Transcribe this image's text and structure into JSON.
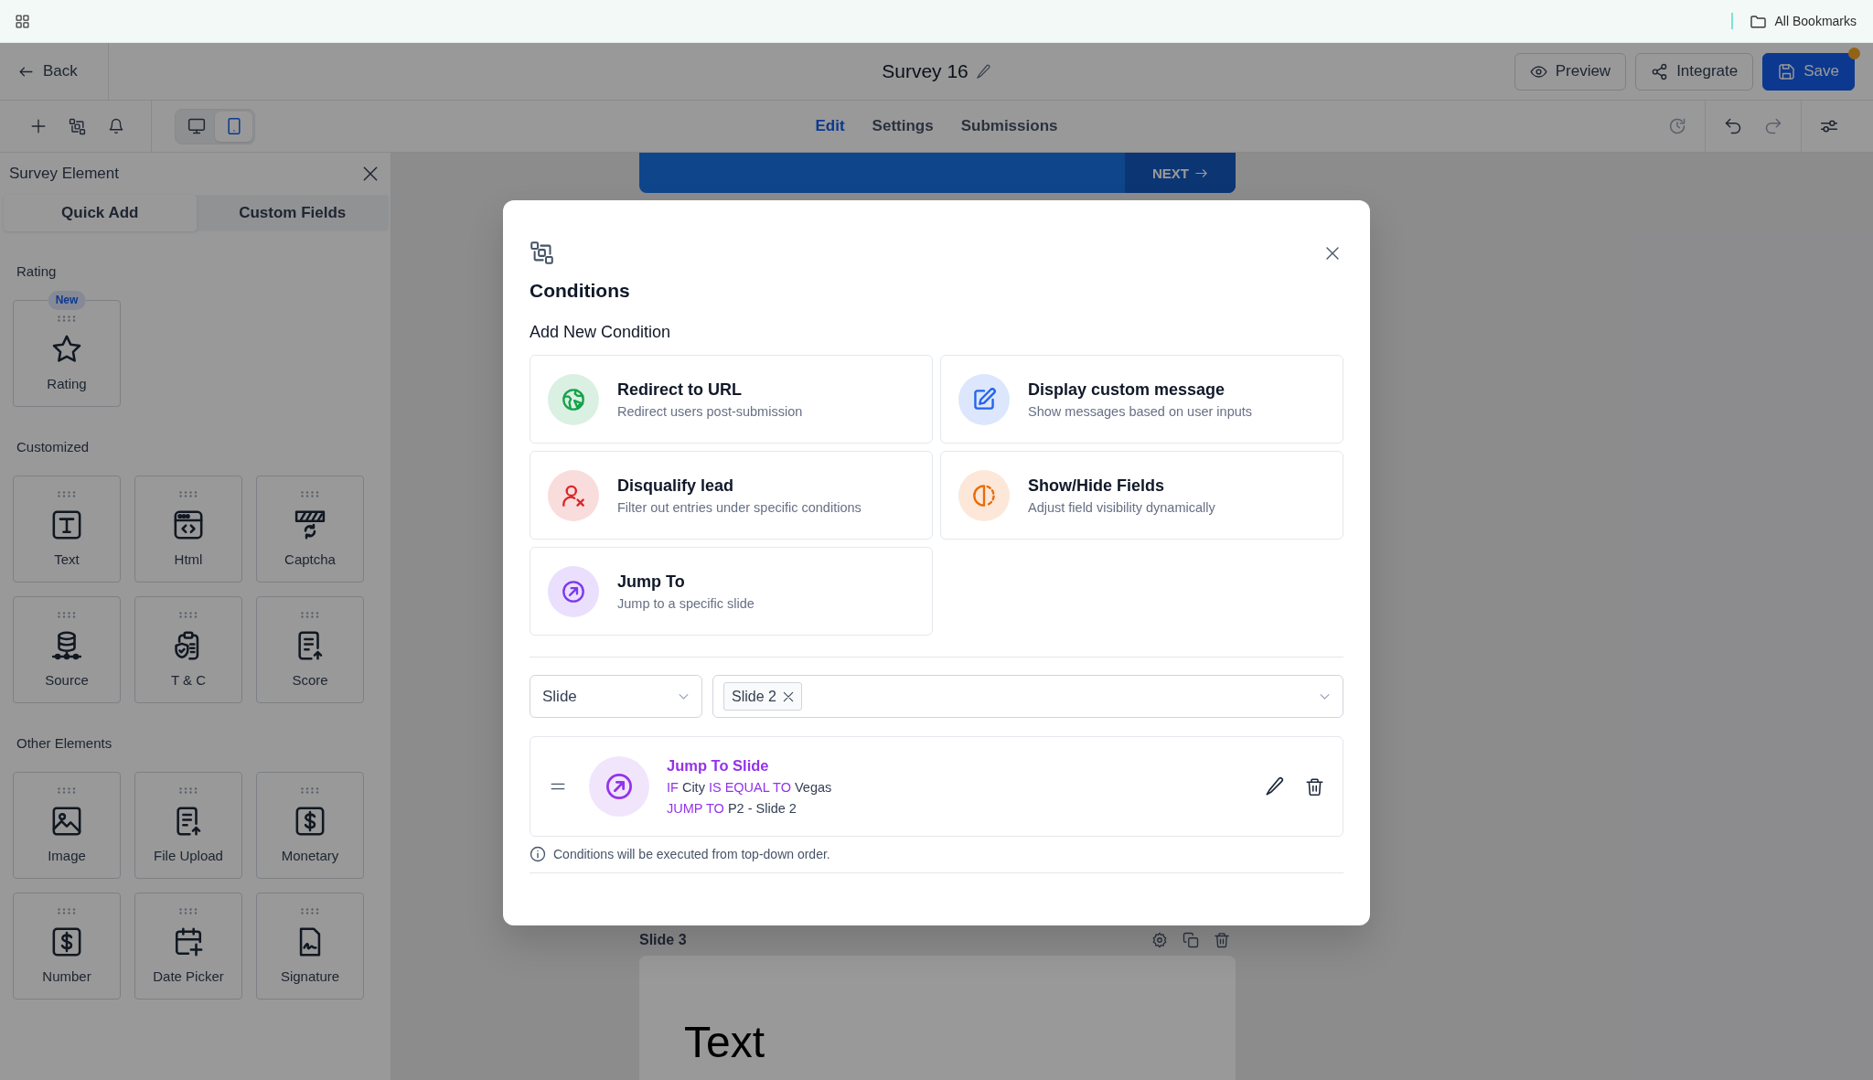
{
  "bookmarks_bar": {
    "label": "All Bookmarks"
  },
  "header": {
    "back": "Back",
    "title": "Survey 16",
    "buttons": [
      {
        "label": "Preview",
        "kind": "outline",
        "indicator": false
      },
      {
        "label": "Integrate",
        "kind": "outline",
        "indicator": false
      },
      {
        "label": "Save",
        "kind": "primary",
        "indicator": true
      }
    ]
  },
  "toolbar": {
    "devices": [
      {
        "selected": false
      },
      {
        "selected": true
      }
    ],
    "tabs": [
      {
        "label": "Edit",
        "selected": true
      },
      {
        "label": "Settings",
        "selected": false
      },
      {
        "label": "Submissions",
        "selected": false
      }
    ],
    "undo_redo": [
      {
        "disabled": false
      },
      {
        "disabled": true
      }
    ]
  },
  "sidebar": {
    "title": "Survey Element",
    "tabs": [
      {
        "label": "Quick Add",
        "selected": true
      },
      {
        "label": "Custom Fields",
        "selected": false
      }
    ],
    "sections": [
      {
        "title": "Rating",
        "items": [
          {
            "label": "Rating",
            "badge": "New"
          }
        ]
      },
      {
        "title": "Customized",
        "items": [
          {
            "label": "Text"
          },
          {
            "label": "Html"
          },
          {
            "label": "Captcha"
          },
          {
            "label": "Source"
          },
          {
            "label": "T & C"
          },
          {
            "label": "Score"
          }
        ]
      },
      {
        "title": "Other Elements",
        "items": [
          {
            "label": "Image"
          },
          {
            "label": "File Upload"
          },
          {
            "label": "Monetary"
          },
          {
            "label": "Number"
          },
          {
            "label": "Date Picker"
          },
          {
            "label": "Signature"
          }
        ]
      }
    ]
  },
  "canvas": {
    "next_button": "NEXT",
    "slide_label": "Slide 3",
    "slide_heading": "Text"
  },
  "modal": {
    "title": "Conditions",
    "subtitle": "Add New Condition",
    "options": [
      {
        "title": "Redirect to URL",
        "description": "Redirect users post-submission",
        "color": "#16a34a"
      },
      {
        "title": "Display custom message",
        "description": "Show messages based on user inputs",
        "color": "#2563eb"
      },
      {
        "title": "Disqualify lead",
        "description": "Filter out entries under specific conditions",
        "color": "#dc2626"
      },
      {
        "title": "Show/Hide Fields",
        "description": "Adjust field visibility dynamically",
        "color": "#ea6c0a"
      },
      {
        "title": "Jump To",
        "description": "Jump to a specific slide",
        "color": "#7c3aed"
      }
    ],
    "type_select": {
      "value": "Slide"
    },
    "target_select": {
      "tags": [
        "Slide 2"
      ]
    },
    "conditions": [
      {
        "title": "Jump To Slide",
        "lines": [
          [
            {
              "kind": "keyword",
              "text": "IF"
            },
            {
              "kind": "value",
              "text": "City"
            },
            {
              "kind": "keyword",
              "text": "IS EQUAL TO"
            },
            {
              "kind": "value",
              "text": "Vegas"
            }
          ],
          [
            {
              "kind": "keyword",
              "text": "JUMP TO"
            },
            {
              "kind": "value",
              "text": "P2 - Slide 2"
            }
          ]
        ]
      }
    ],
    "note": "Conditions will be executed from top-down order."
  }
}
